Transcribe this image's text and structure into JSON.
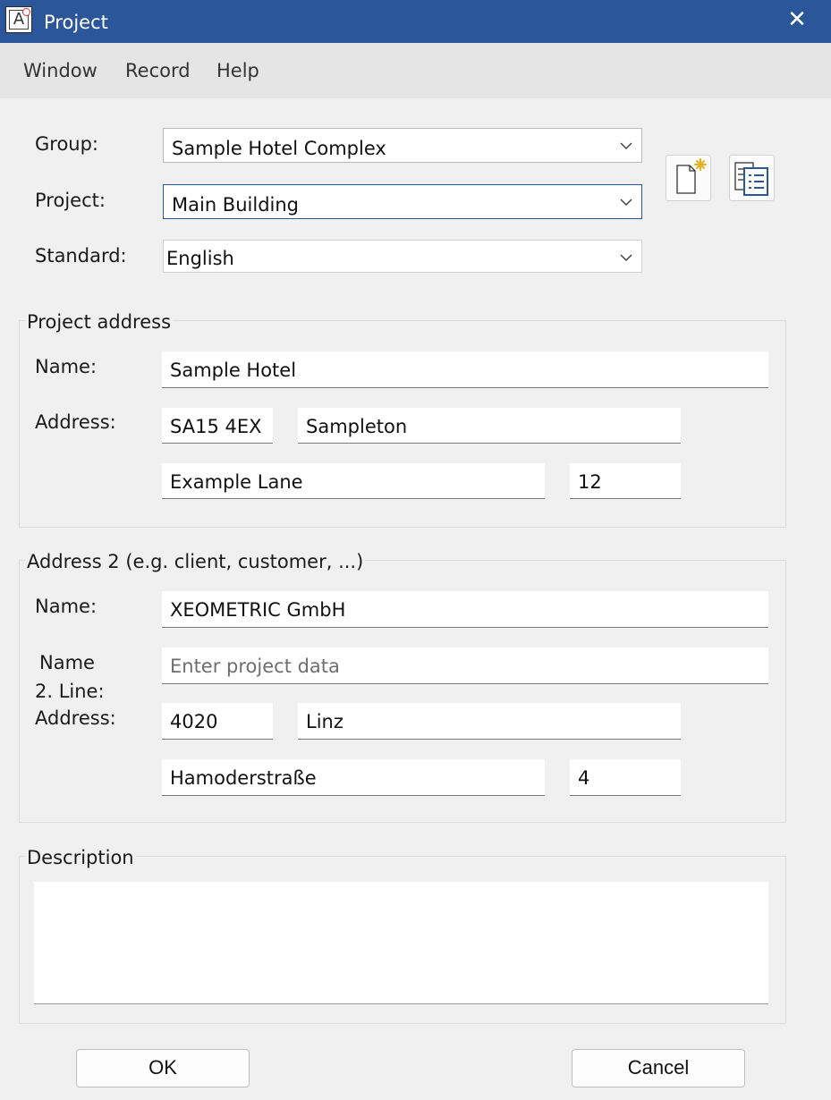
{
  "window": {
    "title": "Project",
    "app_icon_letter": "A",
    "close_symbol": "✕"
  },
  "menu": {
    "items": [
      "Window",
      "Record",
      "Help"
    ]
  },
  "form": {
    "group_label": "Group:",
    "group_value": "Sample Hotel Complex",
    "project_label": "Project:",
    "project_value": "Main Building",
    "standard_label": "Standard:",
    "standard_value": "English"
  },
  "toolbar_icons": {
    "new": "new-document-icon",
    "list": "document-list-icon"
  },
  "project_address": {
    "title": "Project address",
    "name_label": "Name:",
    "name": "Sample Hotel",
    "address_label": "Address:",
    "postcode": "SA15 4EX",
    "city": "Sampleton",
    "street": "Example Lane",
    "number": "12"
  },
  "address2": {
    "title": "Address 2 (e.g. client, customer, ...)",
    "name_label": "Name:",
    "name": "XEOMETRIC GmbH",
    "name2_label_line1": "Name",
    "name2_label_line2": "2. Line:",
    "name2_placeholder": "Enter project data",
    "address_label": "Address:",
    "postcode": "4020",
    "city": "Linz",
    "street": "Hamoderstraße",
    "number": "4"
  },
  "description": {
    "title": "Description",
    "value": ""
  },
  "buttons": {
    "ok": "OK",
    "cancel": "Cancel"
  },
  "colors": {
    "titlebar": "#2b579a",
    "icon_accent": "#2b579a",
    "star": "#e8b020"
  }
}
